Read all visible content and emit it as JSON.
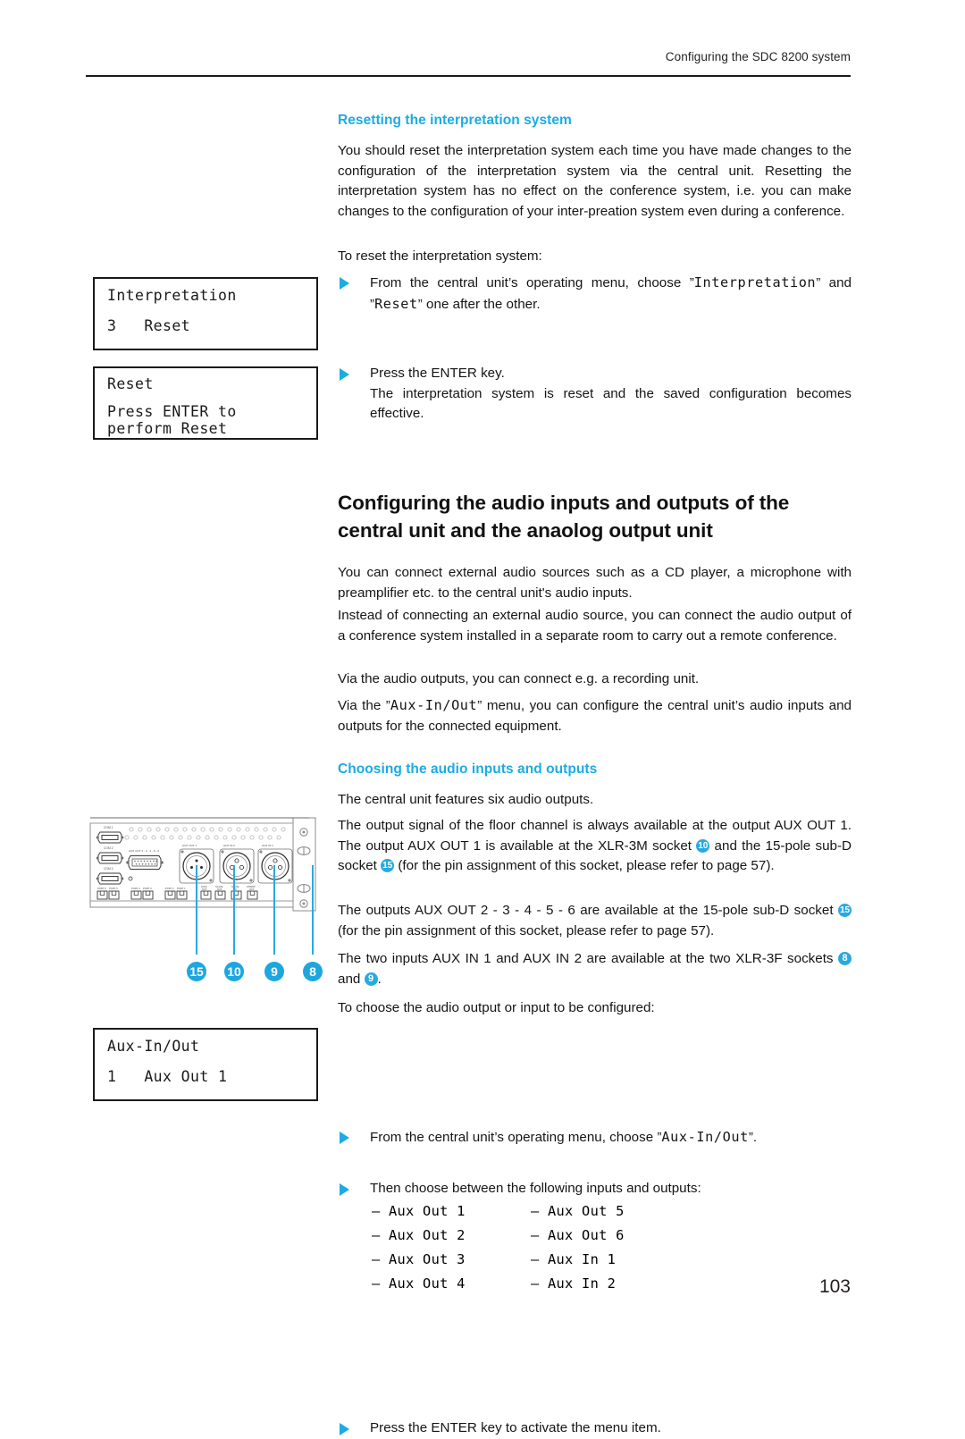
{
  "page": {
    "running_header": "Configuring the SDC 8200 system",
    "number": "103"
  },
  "colors": {
    "accent": "#1cabe3",
    "badge": "#29a9e0",
    "text": "#151515",
    "rule": "#1a1a1a"
  },
  "section_reset": {
    "heading": "Resetting the interpretation system",
    "intro": "You should reset the interpretation system each time you have made changes to the configuration of the interpretation system via the central unit. Resetting the interpretation system has no effect on the conference system, i.e. you can make changes to the configuration of your inter-preation system even during a conference.",
    "lead_in": "To reset the interpretation system:",
    "steps": [
      {
        "pre": "From the central unit’s operating menu, choose ”",
        "lcd1": "Interpretation",
        "mid": "” and ”",
        "lcd2": "Reset",
        "post": "” one after the other."
      },
      {
        "pre": "Press the ENTER key.",
        "detail": "The interpretation system is reset and the saved configuration becomes effective."
      }
    ],
    "lcd_screens": [
      {
        "name": "interpretation-menu-screen",
        "line1": "Interpretation",
        "line2": "3   Reset"
      },
      {
        "name": "reset-confirm-screen",
        "line1": "Reset",
        "line2": "Press ENTER to",
        "line3": "perform Reset"
      }
    ]
  },
  "section_audio": {
    "heading": "Configuring the audio inputs and outputs of the central unit and the anaolog output unit",
    "paragraphs": [
      "You can connect external audio sources such as a CD player, a microphone with preamplifier etc. to the central unit's audio inputs.",
      "Instead of connecting an external audio source, you can connect the audio output of a conference system installed in a separate room to carry out a remote conference.",
      "Via the audio outputs, you can connect e.g. a recording unit."
    ],
    "aux_menu_para": {
      "pre": "Via the ”",
      "lcd": "Aux-In/Out",
      "post": "” menu, you can configure the central unit’s audio inputs and outputs for the connected equipment."
    },
    "sub_heading": "Choosing the audio inputs and outputs",
    "p_six_outputs": "The central unit features six audio outputs.",
    "p_floor": {
      "a": "The output signal of the floor channel is always available at the output AUX OUT 1. The output AUX OUT 1 is available at the XLR-3M socket ",
      "badge1": "10",
      "b": " and the 15-pole sub-D socket ",
      "badge2": "15",
      "c": " (for the pin assignment of this socket, please refer to page 57)."
    },
    "p_outputs_2_6": {
      "a": "The outputs AUX OUT 2 - 3 - 4 - 5 - 6 are available at the 15-pole sub-D socket ",
      "badge1": "15",
      "b": " (for the pin assignment of this socket, please refer to page 57)."
    },
    "p_inputs": {
      "a": "The two inputs AUX IN 1 and AUX IN 2 are available at the two XLR-3F sockets ",
      "badge1": "8",
      "b": " and ",
      "badge2": "9",
      "c": "."
    },
    "lead_in": "To choose the audio output or input to be configured:",
    "steps": [
      {
        "pre": "From the central unit’s operating menu, choose ”",
        "lcd1": "Aux-In/Out",
        "post": "”."
      },
      {
        "pre": "Then choose between the following inputs and outputs:"
      },
      {
        "pre": "Press the ENTER key to activate the menu item."
      }
    ],
    "options": [
      [
        "– Aux Out 1",
        "– Aux Out 5"
      ],
      [
        "– Aux Out 2",
        "– Aux Out 6"
      ],
      [
        "– Aux Out 3",
        "– Aux In 1"
      ],
      [
        "– Aux Out 4",
        "– Aux In 2"
      ]
    ],
    "lcd_screens": [
      {
        "name": "aux-in-out-screen",
        "line1": "Aux-In/Out",
        "line2": "1   Aux Out 1"
      }
    ],
    "panel_diagram": {
      "name": "central-unit-rear-panel",
      "connector_labels": [
        "COM 1",
        "COM 2",
        "COM 3",
        "AUX OUT 2 - 3 - 4 - 5 - 6",
        "AUX OUT 1",
        "AUX IN 2",
        "AUX IN 1"
      ],
      "port_labels": [
        "PORT 6",
        "PORT 5",
        "PORT 4",
        "PORT 3",
        "PORT 2",
        "PORT 1",
        "DATA OUT",
        "SLAVE OUT",
        "SLAVE IN",
        "INTERP OUT"
      ],
      "callouts": [
        "15",
        "10",
        "9",
        "8"
      ]
    }
  }
}
